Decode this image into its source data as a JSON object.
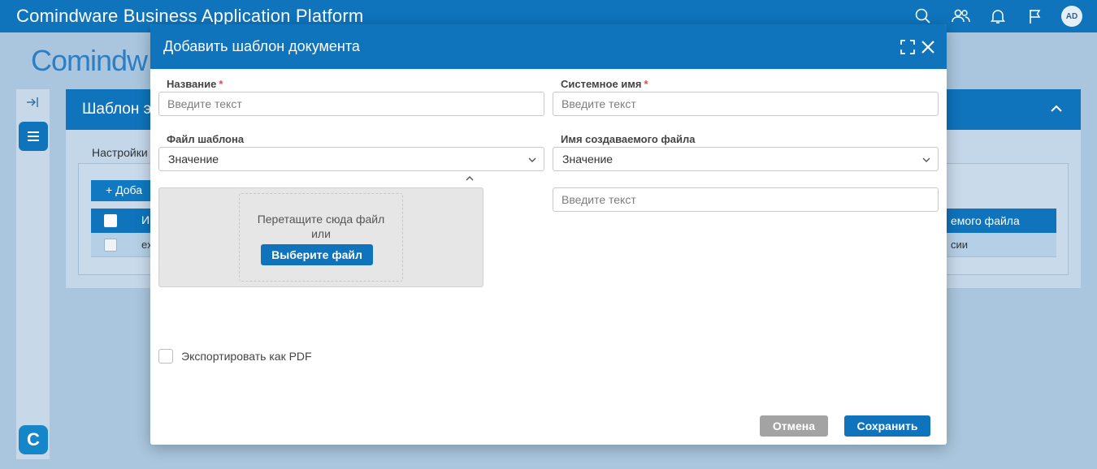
{
  "app": {
    "title": "Comindware Business Application Platform",
    "logo_text": "Comindw",
    "avatar_initials": "AD"
  },
  "background": {
    "panel_title": "Шаблон э",
    "tab_label": "Настройки",
    "add_button": "+ Доба",
    "table_headers": [
      "И",
      "емого файла"
    ],
    "row": [
      "ex",
      "сии"
    ],
    "rail_logo": "C"
  },
  "modal": {
    "title": "Добавить шаблон документа",
    "fields": {
      "name": {
        "label": "Название",
        "required_mark": "*",
        "placeholder": "Введите текст"
      },
      "system_name": {
        "label": "Системное имя",
        "required_mark": "*",
        "placeholder": "Введите текст"
      },
      "template_file": {
        "label": "Файл шаблона",
        "value": "Значение"
      },
      "output_file_name": {
        "label": "Имя создаваемого файла",
        "value": "Значение",
        "placeholder": "Введите текст"
      }
    },
    "dropzone": {
      "text_line1": "Перетащите сюда файл",
      "text_line2": "или",
      "button": "Выберите файл"
    },
    "export_pdf": {
      "label": "Экспортировать как PDF",
      "checked": false
    },
    "buttons": {
      "cancel": "Отмена",
      "save": "Сохранить"
    }
  },
  "colors": {
    "brand_blue": "#0f74bb",
    "required_red": "#e14b3b",
    "cancel_gray": "#a3a3a3"
  }
}
